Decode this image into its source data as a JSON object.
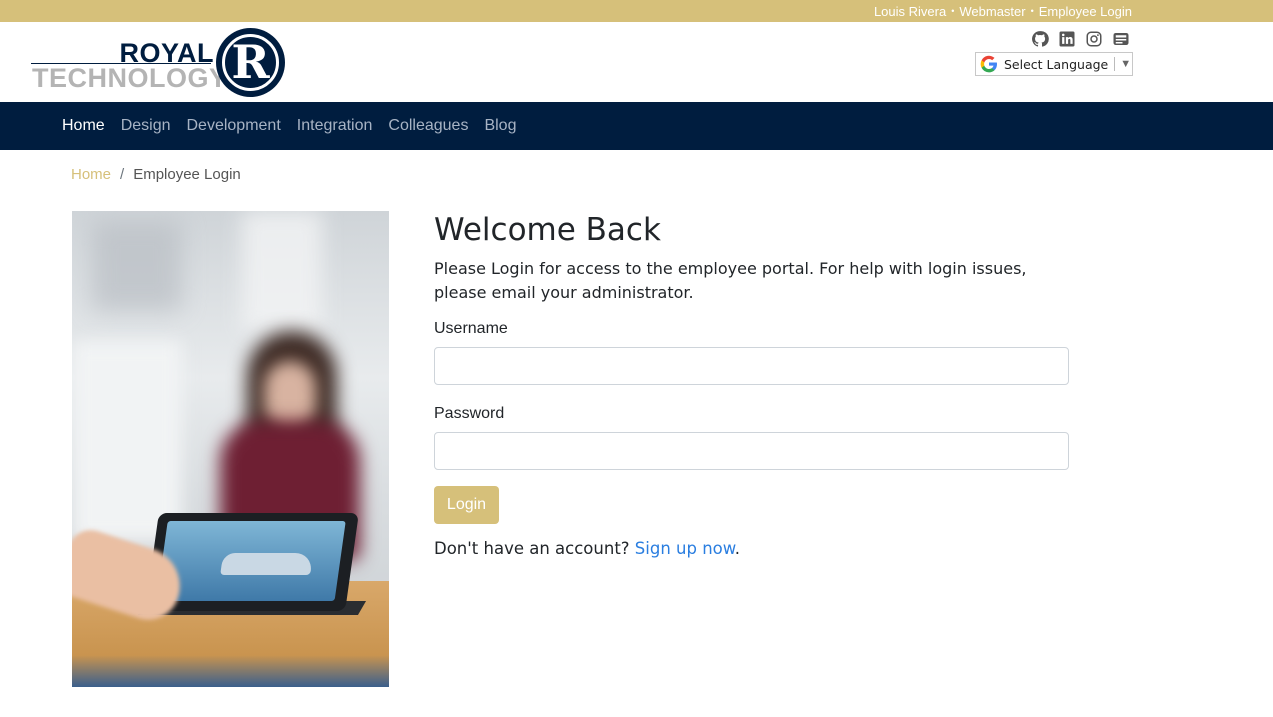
{
  "topbar": {
    "crumbs": [
      "Louis Rivera",
      "Webmaster",
      "Employee Login"
    ],
    "separator": "•"
  },
  "logo": {
    "line1": "ROYAL",
    "line2": "TECHNOLOGY",
    "seal_letter": "R"
  },
  "social": {
    "icons": [
      "github-icon",
      "linkedin-icon",
      "instagram-icon",
      "mailbox-icon"
    ]
  },
  "language": {
    "label": "Select Language",
    "arrow": "▼"
  },
  "nav": {
    "items": [
      "Home",
      "Design",
      "Development",
      "Integration",
      "Colleagues",
      "Blog"
    ],
    "active": "Home"
  },
  "breadcrumb": {
    "home": "Home",
    "separator": "/",
    "current": "Employee Login"
  },
  "login": {
    "title": "Welcome Back",
    "intro": "Please Login for access to the employee portal. For help with login issues, please email your administrator.",
    "username_label": "Username",
    "username_value": "",
    "password_label": "Password",
    "password_value": "",
    "button_label": "Login",
    "signup_prompt": "Don't have an account?",
    "signup_link": "Sign up now",
    "signup_suffix": "."
  },
  "colors": {
    "gold": "#d6c07a",
    "navy": "#001d3f",
    "link": "#2a7ee0"
  }
}
